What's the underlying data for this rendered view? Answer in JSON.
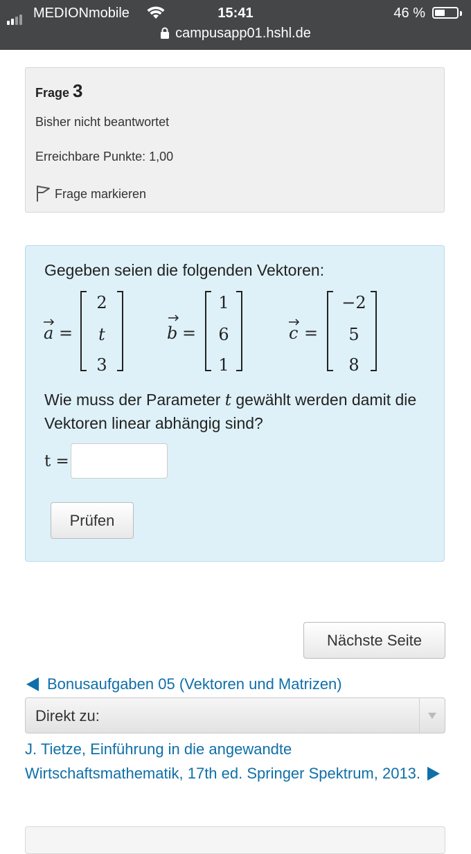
{
  "status_bar": {
    "carrier": "MEDIONmobile",
    "time": "15:41",
    "battery": "46 %",
    "battery_level": 0.46,
    "url": "campusapp01.hshl.de"
  },
  "question_info": {
    "label": "Frage",
    "number": "3",
    "state": "Bisher nicht beantwortet",
    "points": "Erreichbare Punkte: 1,00",
    "flag_label": "Frage markieren"
  },
  "question": {
    "intro": "Gegeben seien die folgenden Vektoren:",
    "vectors": [
      {
        "name": "a",
        "values": [
          "2",
          "t",
          "3"
        ]
      },
      {
        "name": "b",
        "values": [
          "1",
          "6",
          "1"
        ]
      },
      {
        "name": "c",
        "values": [
          "−2",
          "5",
          "8"
        ]
      }
    ],
    "prompt_before": "Wie muss der Parameter ",
    "prompt_var": "t",
    "prompt_after": " gewählt werden damit die Vektoren linear abhängig sind?",
    "answer_label": "t =",
    "answer_value": "",
    "check_button": "Prüfen"
  },
  "navigation": {
    "next_page": "Nächste Seite",
    "prev_activity": "Bonusaufgaben 05 (Vektoren und Matrizen)",
    "jump_select": "Direkt zu:",
    "next_activity": "J. Tietze, Einführung in die angewandte Wirtschaftsmathematik, 17th ed. Springer Spektrum, 2013."
  }
}
